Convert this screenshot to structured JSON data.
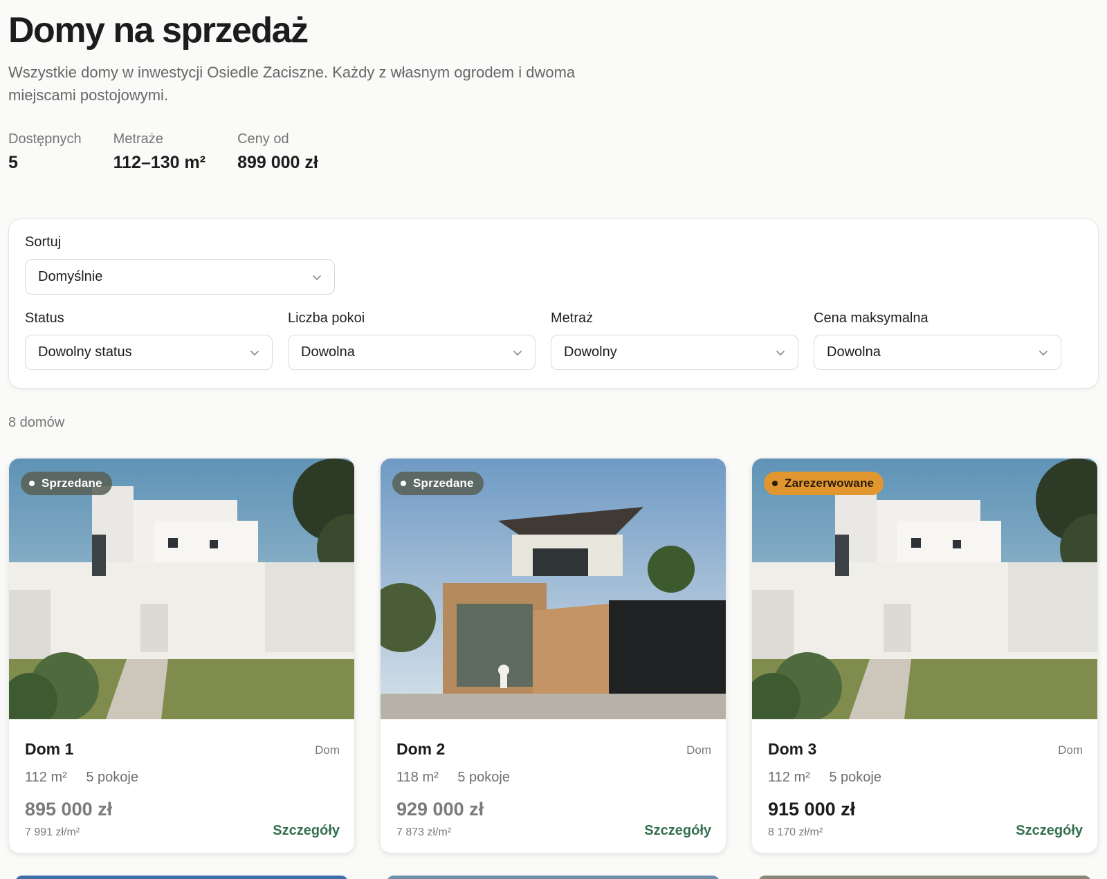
{
  "header": {
    "title": "Domy na sprzedaż",
    "subtitle": "Wszystkie domy w inwestycji Osiedle Zaciszne. Każdy z własnym ogrodem i dwoma miejscami postojowymi."
  },
  "stats": [
    {
      "label": "Dostępnych",
      "value": "5"
    },
    {
      "label": "Metraże",
      "value": "112–130 m²"
    },
    {
      "label": "Ceny od",
      "value": "899 000 zł"
    }
  ],
  "filters": {
    "sort": {
      "label": "Sortuj",
      "value": "Domyślnie"
    },
    "status": {
      "label": "Status",
      "value": "Dowolny status"
    },
    "rooms": {
      "label": "Liczba pokoi",
      "value": "Dowolna"
    },
    "area": {
      "label": "Metraż",
      "value": "Dowolny"
    },
    "max_price": {
      "label": "Cena maksymalna",
      "value": "Dowolna"
    }
  },
  "results_count": "8 domów",
  "cards": [
    {
      "badge": "Sprzedane",
      "name": "Dom 1",
      "type": "Dom",
      "area": "112 m²",
      "rooms": "5 pokoje",
      "price": "895 000 zł",
      "price_per_m2": "7 991 zł/m²",
      "details": "Szczegóły"
    },
    {
      "badge": "Sprzedane",
      "name": "Dom 2",
      "type": "Dom",
      "area": "118 m²",
      "rooms": "5 pokoje",
      "price": "929 000 zł",
      "price_per_m2": "7 873 zł/m²",
      "details": "Szczegóły"
    },
    {
      "badge": "Zarezerwowane",
      "name": "Dom 3",
      "type": "Dom",
      "area": "112 m²",
      "rooms": "5 pokoje",
      "price": "915 000 zł",
      "price_per_m2": "8 170 zł/m²",
      "details": "Szczegóły"
    }
  ],
  "colors": {
    "accent_green": "#33704f",
    "badge_sold": "#586054",
    "badge_reserved": "#e2962f"
  }
}
